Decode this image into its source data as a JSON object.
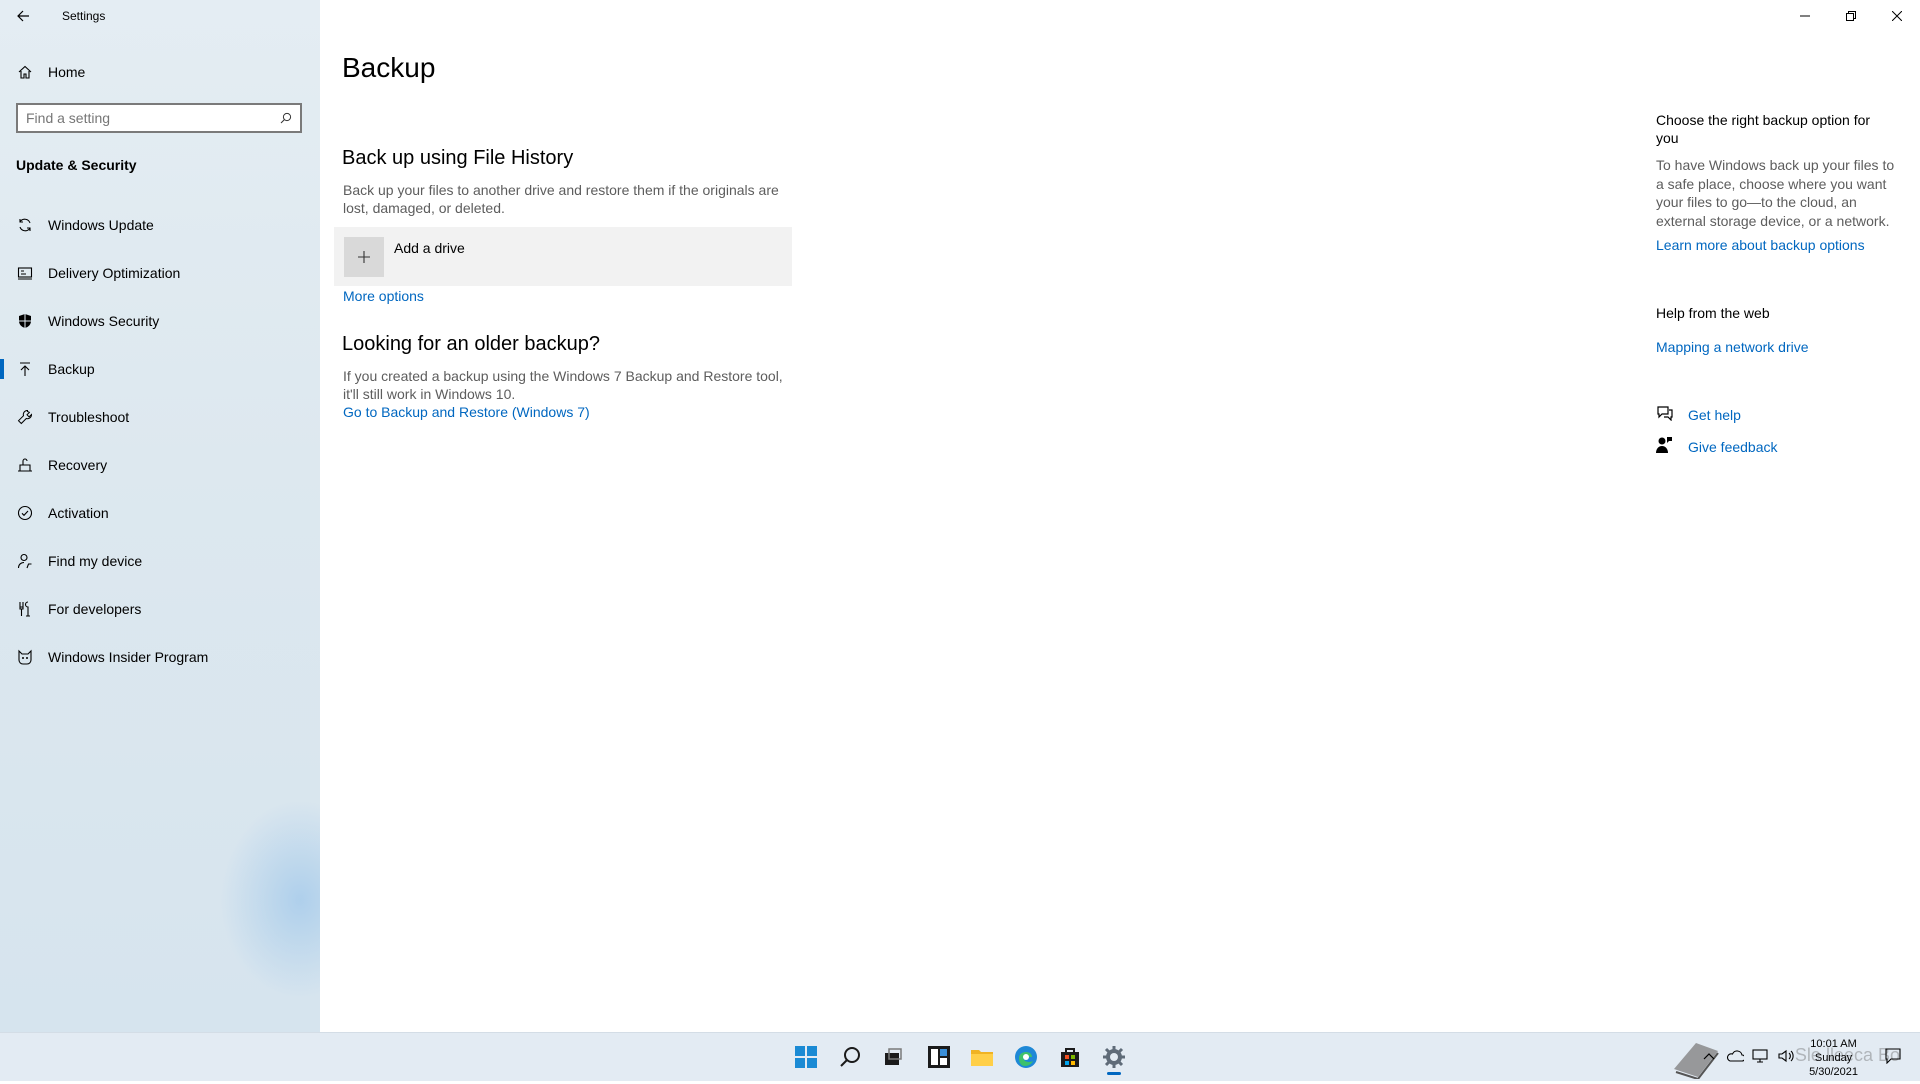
{
  "window": {
    "app_title": "Settings",
    "minimize_icon": "minimize-icon",
    "restore_icon": "restore-icon",
    "close_icon": "close-icon"
  },
  "sidebar": {
    "home_label": "Home",
    "search": {
      "placeholder": "Find a setting"
    },
    "section_title": "Update & Security",
    "items": [
      {
        "label": "Windows Update",
        "icon": "sync-icon"
      },
      {
        "label": "Delivery Optimization",
        "icon": "delivery-optimization-icon"
      },
      {
        "label": "Windows Security",
        "icon": "shield-icon"
      },
      {
        "label": "Backup",
        "icon": "backup-upload-icon",
        "selected": true
      },
      {
        "label": "Troubleshoot",
        "icon": "wrench-icon"
      },
      {
        "label": "Recovery",
        "icon": "recovery-icon"
      },
      {
        "label": "Activation",
        "icon": "check-circle-icon"
      },
      {
        "label": "Find my device",
        "icon": "person-location-icon"
      },
      {
        "label": "For developers",
        "icon": "developer-tools-icon"
      },
      {
        "label": "Windows Insider Program",
        "icon": "insider-cat-icon"
      }
    ]
  },
  "main": {
    "page_title": "Backup",
    "file_history": {
      "heading": "Back up using File History",
      "description": "Back up your files to another drive and restore them if the originals are lost, damaged, or deleted.",
      "add_drive_label": "Add a drive",
      "more_options": "More options"
    },
    "older_backup": {
      "heading": "Looking for an older backup?",
      "description": "If you created a backup using the Windows 7 Backup and Restore tool, it'll still work in Windows 10.",
      "link": "Go to Backup and Restore (Windows 7)"
    }
  },
  "right_pane": {
    "choose_title": "Choose the right backup option for you",
    "choose_text": "To have Windows back up your files to a safe place, choose where you want your files to go—to the cloud, an external storage device, or a network.",
    "learn_more": "Learn more about backup options",
    "help_title": "Help from the web",
    "mapping_link": "Mapping a network drive",
    "get_help": "Get help",
    "give_feedback": "Give feedback"
  },
  "taskbar": {
    "apps": [
      "start-icon",
      "search-icon",
      "task-view-icon",
      "widgets-icon",
      "file-explorer-icon",
      "edge-icon",
      "store-icon",
      "settings-gear-icon"
    ],
    "active_app": "settings-gear-icon",
    "time": "10:01 AM",
    "day": "Sunday",
    "date": "5/30/2021",
    "watermark": "Sle lleeca Bo"
  },
  "colors": {
    "accent": "#0067c0",
    "sidebar_bg": "#dde8ef",
    "taskbar_bg": "#e3ebf3"
  }
}
